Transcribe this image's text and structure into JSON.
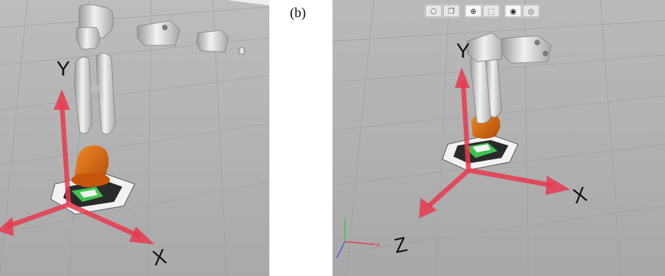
{
  "caption": {
    "label": "(b)"
  },
  "panel_a": {
    "axis_labels": {
      "y": "Y",
      "x": "X"
    }
  },
  "panel_b": {
    "axis_labels": {
      "y": "Y",
      "x": "X",
      "z": "Z"
    },
    "toolbar": {
      "groups": [
        {
          "buttons": [
            {
              "icon": "cube-icon",
              "glyph": "⬡"
            },
            {
              "icon": "copy-icon",
              "glyph": "❐"
            }
          ]
        },
        {
          "buttons": [
            {
              "icon": "zoom-icon",
              "glyph": "⊕"
            },
            {
              "icon": "select-icon",
              "glyph": "⬚"
            }
          ]
        },
        {
          "buttons": [
            {
              "icon": "eye-hidden-icon",
              "glyph": "◉"
            },
            {
              "icon": "eye-icon",
              "glyph": "◎"
            }
          ]
        }
      ]
    }
  },
  "colors": {
    "floor": "#b3b3b3",
    "grid": "#a3a3a3",
    "axis_red": "#e83a4f",
    "robot_orange": "#d9620f",
    "robot_silver": "#d8d8d8",
    "marker_green": "#3fc34f"
  }
}
